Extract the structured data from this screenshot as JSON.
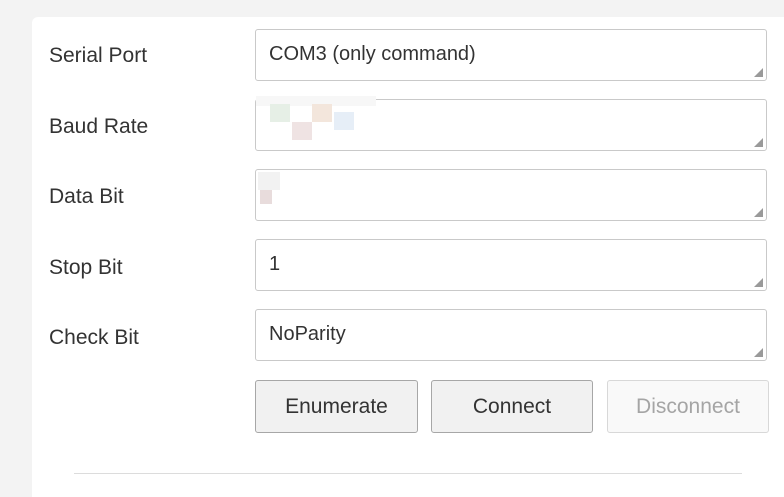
{
  "form": {
    "serial_port": {
      "label": "Serial Port",
      "value": "COM3 (only command)"
    },
    "baud_rate": {
      "label": "Baud Rate",
      "value": ""
    },
    "data_bit": {
      "label": "Data Bit",
      "value": ""
    },
    "stop_bit": {
      "label": "Stop Bit",
      "value": "1"
    },
    "check_bit": {
      "label": "Check Bit",
      "value": "NoParity"
    }
  },
  "buttons": {
    "enumerate": "Enumerate",
    "connect": "Connect",
    "disconnect": "Disconnect"
  }
}
